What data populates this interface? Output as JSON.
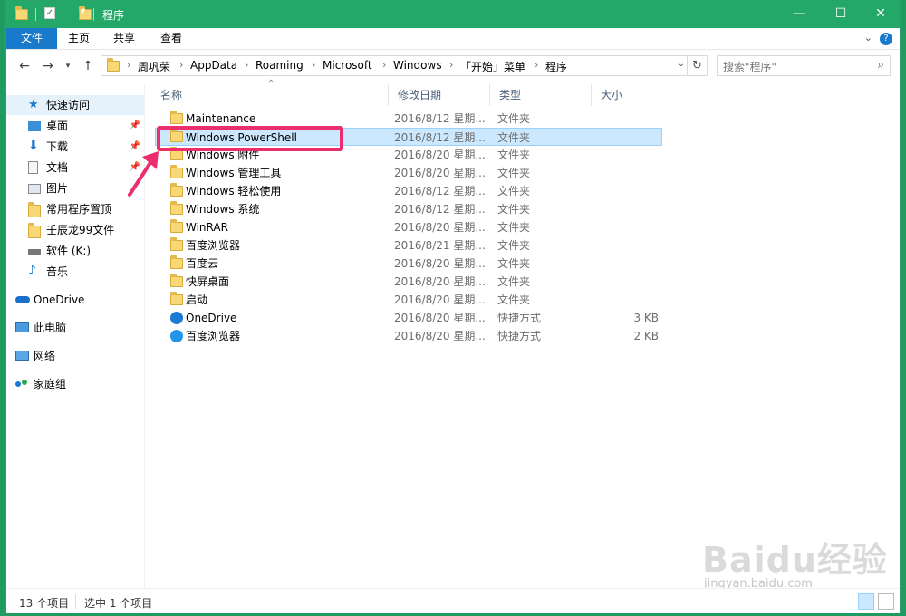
{
  "window": {
    "title": "程序"
  },
  "ribbon": {
    "tabs": [
      "文件",
      "主页",
      "共享",
      "查看"
    ]
  },
  "address": {
    "crumbs": [
      "周巩荣",
      "AppData",
      "Roaming",
      "Microsoft",
      "Windows",
      "「开始」菜单",
      "程序"
    ],
    "search_placeholder": "搜索\"程序\""
  },
  "nav": {
    "items": [
      {
        "label": "快速访问",
        "icon": "star-icon"
      },
      {
        "label": "桌面",
        "icon": "desktop-icon"
      },
      {
        "label": "下载",
        "icon": "download-icon"
      },
      {
        "label": "文档",
        "icon": "document-icon"
      },
      {
        "label": "图片",
        "icon": "picture-icon"
      },
      {
        "label": "常用程序置顶",
        "icon": "folder-icon"
      },
      {
        "label": "壬辰龙99文件",
        "icon": "folder-icon"
      },
      {
        "label": "软件 (K:)",
        "icon": "drive-icon"
      },
      {
        "label": "音乐",
        "icon": "music-icon"
      },
      {
        "label": "OneDrive",
        "icon": "cloud-icon"
      },
      {
        "label": "此电脑",
        "icon": "computer-icon"
      },
      {
        "label": "网络",
        "icon": "network-icon"
      },
      {
        "label": "家庭组",
        "icon": "homegroup-icon"
      }
    ]
  },
  "columns": {
    "name": "名称",
    "date": "修改日期",
    "type": "类型",
    "size": "大小"
  },
  "files": [
    {
      "name": "Maintenance",
      "date": "2016/8/12 星期...",
      "type": "文件夹",
      "size": ""
    },
    {
      "name": "Windows PowerShell",
      "date": "2016/8/12 星期...",
      "type": "文件夹",
      "size": ""
    },
    {
      "name": "Windows 附件",
      "date": "2016/8/20 星期...",
      "type": "文件夹",
      "size": ""
    },
    {
      "name": "Windows 管理工具",
      "date": "2016/8/20 星期...",
      "type": "文件夹",
      "size": ""
    },
    {
      "name": "Windows 轻松使用",
      "date": "2016/8/12 星期...",
      "type": "文件夹",
      "size": ""
    },
    {
      "name": "Windows 系统",
      "date": "2016/8/12 星期...",
      "type": "文件夹",
      "size": ""
    },
    {
      "name": "WinRAR",
      "date": "2016/8/20 星期...",
      "type": "文件夹",
      "size": ""
    },
    {
      "name": "百度浏览器",
      "date": "2016/8/21 星期...",
      "type": "文件夹",
      "size": ""
    },
    {
      "name": "百度云",
      "date": "2016/8/20 星期...",
      "type": "文件夹",
      "size": ""
    },
    {
      "name": "快屏桌面",
      "date": "2016/8/20 星期...",
      "type": "文件夹",
      "size": ""
    },
    {
      "name": "启动",
      "date": "2016/8/20 星期...",
      "type": "文件夹",
      "size": ""
    },
    {
      "name": "OneDrive",
      "date": "2016/8/20 星期...",
      "type": "快捷方式",
      "size": "3 KB"
    },
    {
      "name": "百度浏览器",
      "date": "2016/8/20 星期...",
      "type": "快捷方式",
      "size": "2 KB"
    }
  ],
  "status": {
    "count": "13 个项目",
    "selected": "选中 1 个项目"
  },
  "watermark": {
    "brand": "Baidu经验",
    "url": "jingyan.baidu.com"
  },
  "colors": {
    "titlebar": "#23a86a",
    "file_tab": "#1979ca",
    "highlight": "#ec2e6e",
    "selection": "#cce8ff"
  }
}
